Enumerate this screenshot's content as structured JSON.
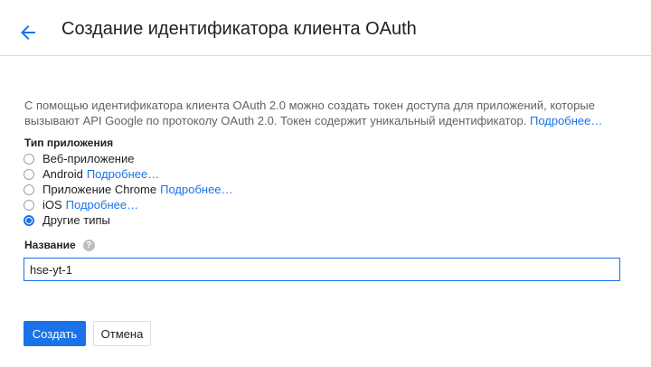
{
  "header": {
    "title": "Создание идентификатора клиента OAuth",
    "back_icon": "arrow-left-icon"
  },
  "description": {
    "text": "С помощью идентификатора клиента OAuth 2.0 можно создать токен доступа для приложений, которые вызывают API Google по протоколу OAuth 2.0. Токен содержит уникальный идентификатор.",
    "link": "Подробнее…"
  },
  "app_type": {
    "label": "Тип приложения",
    "options": [
      {
        "label": "Веб-приложение",
        "link": "",
        "checked": false
      },
      {
        "label": "Android",
        "link": "Подробнее…",
        "checked": false
      },
      {
        "label": "Приложение Chrome",
        "link": "Подробнее…",
        "checked": false
      },
      {
        "label": "iOS",
        "link": "Подробнее…",
        "checked": false
      },
      {
        "label": "Другие типы",
        "link": "",
        "checked": true
      }
    ]
  },
  "name": {
    "label": "Название",
    "value": "hse-yt-1",
    "help_icon": "help-icon",
    "help_glyph": "?"
  },
  "actions": {
    "create_label": "Создать",
    "cancel_label": "Отмена"
  },
  "colors": {
    "accent": "#1a73e8",
    "text": "#202124",
    "muted": "#5f6368"
  }
}
